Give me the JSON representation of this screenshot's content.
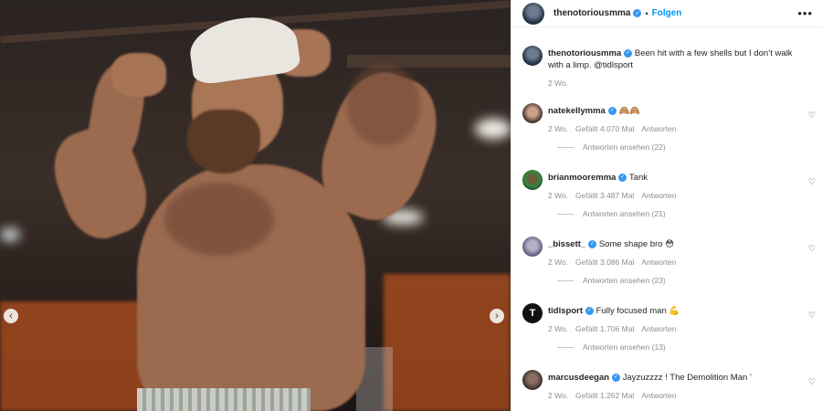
{
  "post": {
    "author": "thenotoriousmma",
    "separator": "•",
    "follow_label": "Folgen",
    "more_label": "•••",
    "caption": "Been hit with a few shells but I don’t walk with a limp. @tidlsport",
    "caption_time": "2 Wo."
  },
  "media": {
    "prev_arrow": "‹",
    "next_arrow": "›"
  },
  "icons": {
    "verified": "✓",
    "heart": "♡"
  },
  "comments": [
    {
      "username": "natekellymma",
      "text": "🙈🙈",
      "time": "2 Wo.",
      "likes": "Gefällt 4.070 Mal",
      "reply": "Antworten",
      "view_replies": "Antworten ansehen (22)"
    },
    {
      "username": "brianmooremma",
      "text": "Tank",
      "time": "2 Wo.",
      "likes": "Gefällt 3.487 Mal",
      "reply": "Antworten",
      "view_replies": "Antworten ansehen (21)"
    },
    {
      "username": "_bissett_",
      "text": "Some shape bro 😳",
      "time": "2 Wo.",
      "likes": "Gefällt 3.086 Mal",
      "reply": "Antworten",
      "view_replies": "Antworten ansehen (23)"
    },
    {
      "username": "tidlsport",
      "avatar_letter": "T",
      "text": "Fully focused man 💪",
      "time": "2 Wo.",
      "likes": "Gefällt 1.706 Mal",
      "reply": "Antworten",
      "view_replies": "Antworten ansehen (13)"
    },
    {
      "username": "marcusdeegan",
      "text": "Jayzuzzzz ! The Demolition Man ’",
      "time": "2 Wo.",
      "likes": "Gefällt 1.262 Mal",
      "reply": "Antworten"
    }
  ]
}
